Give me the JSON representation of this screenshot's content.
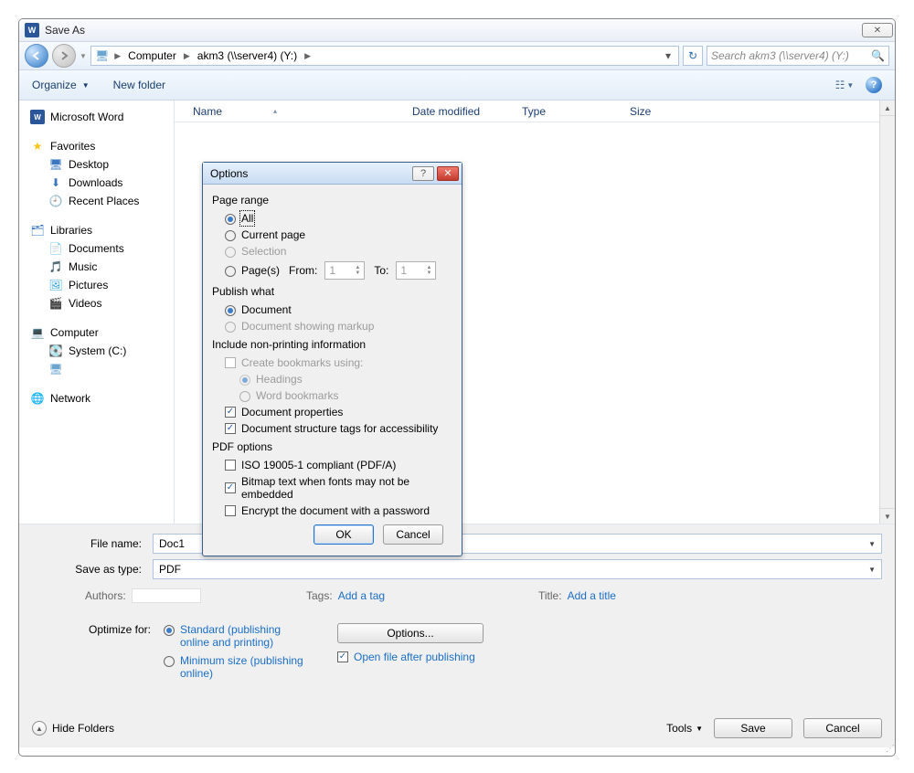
{
  "title": "Save As",
  "breadcrumb": {
    "root": "Computer",
    "loc": "akm3 (\\\\server4) (Y:)"
  },
  "search": {
    "placeholder": "Search akm3 (\\\\server4) (Y:)"
  },
  "toolbar": {
    "organize": "Organize",
    "newfolder": "New folder"
  },
  "listheader": {
    "name": "Name",
    "date": "Date modified",
    "type": "Type",
    "size": "Size"
  },
  "sidebar": {
    "word": "Microsoft Word",
    "favorites": "Favorites",
    "favorites_children": {
      "desktop": "Desktop",
      "downloads": "Downloads",
      "recent": "Recent Places"
    },
    "libraries": "Libraries",
    "libraries_children": {
      "documents": "Documents",
      "music": "Music",
      "pictures": "Pictures",
      "videos": "Videos"
    },
    "computer": "Computer",
    "computer_children": {
      "system": "System (C:)"
    },
    "network": "Network"
  },
  "file": {
    "name_label": "File name:",
    "name_value": "Doc1",
    "type_label": "Save as type:",
    "type_value": "PDF"
  },
  "meta": {
    "authors_label": "Authors:",
    "authors_value": "",
    "tags_label": "Tags:",
    "tags_value": "Add a tag",
    "title_label": "Title:",
    "title_value": "Add a title"
  },
  "optimize": {
    "label": "Optimize for:",
    "standard": "Standard (publishing online and printing)",
    "minimum": "Minimum size (publishing online)"
  },
  "midbuttons": {
    "options": "Options...",
    "openafter": "Open file after publishing"
  },
  "footerbtns": {
    "hide": "Hide Folders",
    "tools": "Tools",
    "save": "Save",
    "cancel": "Cancel"
  },
  "dialog": {
    "title": "Options",
    "page_range": "Page range",
    "all": "All",
    "current": "Current page",
    "selection": "Selection",
    "pages": "Page(s)",
    "from": "From:",
    "from_val": "1",
    "to": "To:",
    "to_val": "1",
    "publish_what": "Publish what",
    "document": "Document",
    "doc_markup": "Document showing markup",
    "include_np": "Include non-printing information",
    "create_bm": "Create bookmarks using:",
    "headings": "Headings",
    "word_bm": "Word bookmarks",
    "docprops": "Document properties",
    "docstruct": "Document structure tags for accessibility",
    "pdf_options": "PDF options",
    "iso": "ISO 19005-1 compliant (PDF/A)",
    "bitmap": "Bitmap text when fonts may not be embedded",
    "encrypt": "Encrypt the document with a password",
    "ok": "OK",
    "cancel": "Cancel"
  }
}
